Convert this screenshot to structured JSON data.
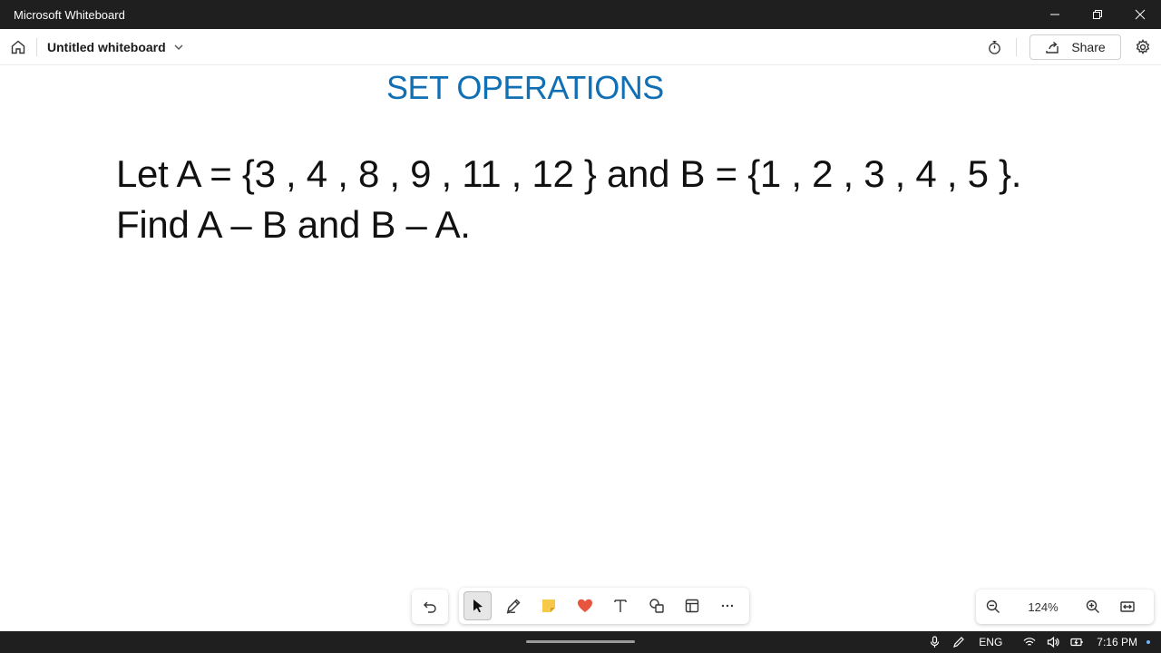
{
  "window": {
    "title": "Microsoft Whiteboard"
  },
  "appbar": {
    "board_title": "Untitled whiteboard",
    "share_label": "Share"
  },
  "canvas": {
    "heading": "SET OPERATIONS",
    "line1": "Let A = {3 , 4 , 8 , 9 , 11 , 12 } and B = {1 , 2 , 3 , 4 , 5 }.",
    "line2": "Find A – B and B – A."
  },
  "zoom": {
    "level": "124%"
  },
  "taskbar": {
    "language": "ENG",
    "time": "7:16 PM"
  },
  "colors": {
    "heading": "#1170b3",
    "titlebar": "#1f1f1f",
    "sticky_note": "#f7c948",
    "heart": "#e8553e"
  },
  "icons": [
    "home-icon",
    "chevron-down-icon",
    "timer-icon",
    "share-icon",
    "settings-icon",
    "undo-icon",
    "select-icon",
    "pen-icon",
    "sticky-note-icon",
    "heart-icon",
    "text-icon",
    "shapes-icon",
    "templates-icon",
    "more-icon",
    "zoom-out-icon",
    "zoom-in-icon",
    "fit-width-icon"
  ]
}
